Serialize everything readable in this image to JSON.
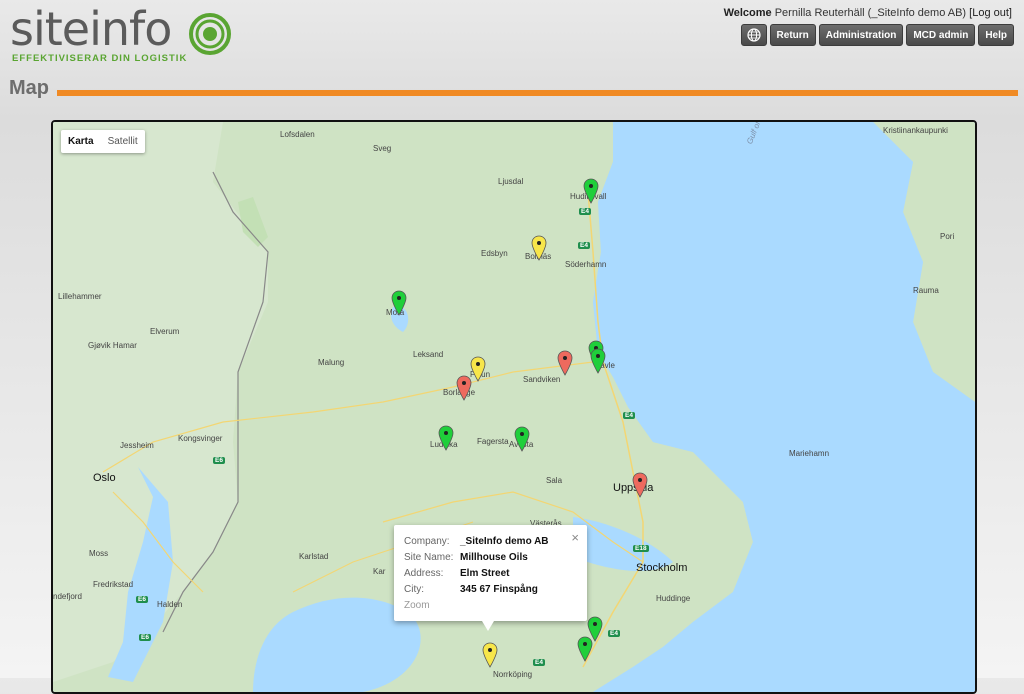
{
  "header": {
    "logo_text": "siteinfo",
    "tagline": "EFFEKTIVISERAR DIN LOGISTIK",
    "welcome_prefix": "Welcome",
    "user": "Pernilla Reuterhäll (_SiteInfo demo AB)",
    "logout": "[Log out]",
    "buttons": {
      "return": "Return",
      "administration": "Administration",
      "mcd_admin": "MCD admin",
      "help": "Help"
    },
    "globe_icon": "globe-icon"
  },
  "page": {
    "title": "Map",
    "accent_color": "#f08a24"
  },
  "map": {
    "type_controls": {
      "map": "Karta",
      "satellite": "Satellit"
    },
    "labels": {
      "lofsdalen": "Lofsdalen",
      "sveg": "Sveg",
      "ljusdal": "Ljusdal",
      "hudiksvall": "Hudiksvall",
      "edsbyn": "Edsbyn",
      "bollnas": "Bollnäs",
      "soderhamn": "Söderhamn",
      "mora": "Mora",
      "lillehammer": "Lillehammer",
      "elverum": "Elverum",
      "gjovik_hamar": "Gjøvik Hamar",
      "leksand": "Leksand",
      "malung": "Malung",
      "falun": "Falun",
      "borlange": "Borlänge",
      "sandviken": "Sandviken",
      "gavle": "Gävle",
      "jessheim": "Jessheim",
      "kongsvinger": "Kongsvinger",
      "ludvika": "Ludvika",
      "avesta": "Avesta",
      "fagersta": "Fagersta",
      "sala": "Sala",
      "oslo": "Oslo",
      "uppsala": "Uppsala",
      "vasteras": "Västerås",
      "karlstad": "Karlstad",
      "moss": "Moss",
      "fredrikstad": "Fredrikstad",
      "halden": "Halden",
      "sandefjord": "ndefjord",
      "stockholm": "Stockholm",
      "huddinge": "Huddinge",
      "norrkoping": "Norrköping",
      "pori": "Pori",
      "rauma": "Rauma",
      "kristiinankaupunki": "Kristiinankaupunki",
      "mariehamn": "Mariehamn",
      "gulf": "Gulf of Bothnia",
      "kar": "Kar"
    },
    "roads": {
      "e4": "E4",
      "e6": "E6",
      "e18": "E18"
    },
    "pin_colors": {
      "green": "#1fcf3a",
      "yellow": "#f7e64a",
      "red": "#ee6a5e"
    }
  },
  "infowindow": {
    "rows": [
      {
        "key": "Company:",
        "value": "_SiteInfo demo AB"
      },
      {
        "key": "Site Name:",
        "value": "Millhouse Oils"
      },
      {
        "key": "Address:",
        "value": "Elm Street"
      },
      {
        "key": "City:",
        "value": "345 67 Finspång"
      }
    ],
    "zoom": "Zoom",
    "close": "×"
  }
}
